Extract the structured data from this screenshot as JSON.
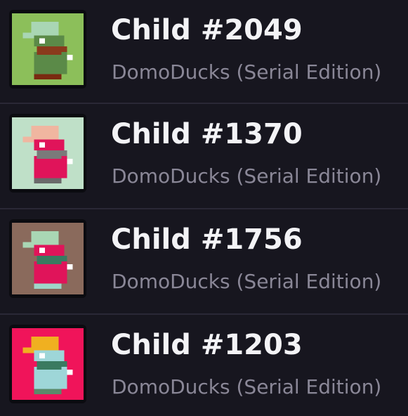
{
  "items": [
    {
      "title": "Child #2049",
      "collection": "DomoDucks (Serial Edition)",
      "bg": "#8cbf5a",
      "hat": "#a9d6b4",
      "body": "#5b8a48",
      "visor": "#8a3a1c",
      "feet": "#7a2a10",
      "thumb_icon": "pixel-duck-green"
    },
    {
      "title": "Child #1370",
      "collection": "DomoDucks (Serial Edition)",
      "bg": "#bfe0c8",
      "hat": "#f0b6a0",
      "body": "#e0145a",
      "visor": "#7a7a7a",
      "feet": "#6a6a6a",
      "thumb_icon": "pixel-duck-pink"
    },
    {
      "title": "Child #1756",
      "collection": "DomoDucks (Serial Edition)",
      "bg": "#8a6a5c",
      "hat": "#a9d6b4",
      "body": "#e0145a",
      "visor": "#3a7a60",
      "feet": "#9ed6c8",
      "thumb_icon": "pixel-duck-brown"
    },
    {
      "title": "Child #1203",
      "collection": "DomoDucks (Serial Edition)",
      "bg": "#f0145a",
      "hat": "#f0b020",
      "body": "#9ed6d8",
      "visor": "#3a7a60",
      "feet": "#5a8a6a",
      "thumb_icon": "pixel-duck-red"
    }
  ]
}
